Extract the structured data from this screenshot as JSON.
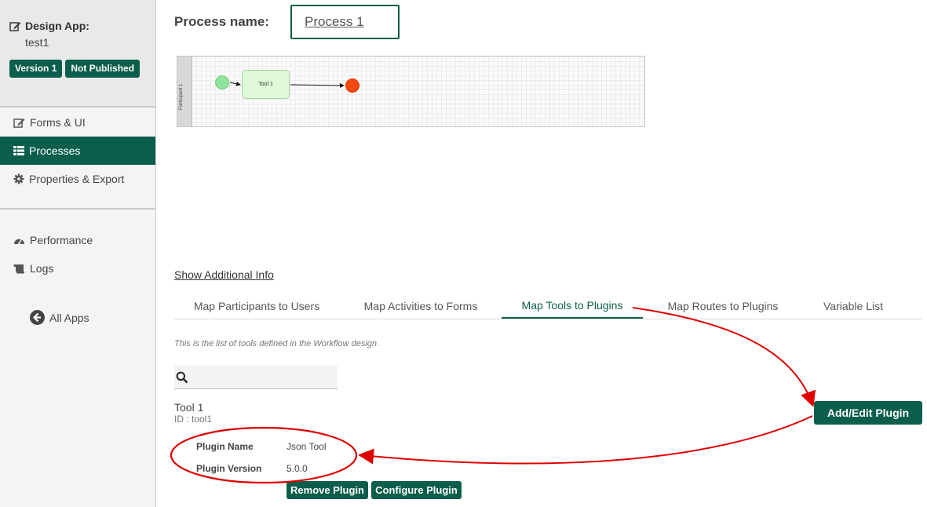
{
  "sidebar": {
    "app_title": "Design App:",
    "app_name": "test1",
    "badges": [
      "Version 1",
      "Not Published"
    ],
    "nav": [
      {
        "label": "Forms & UI",
        "icon": "edit-icon"
      },
      {
        "label": "Processes",
        "icon": "table-icon",
        "active": true
      },
      {
        "label": "Properties & Export",
        "icon": "gear-icon"
      },
      {
        "label": "Performance",
        "icon": "gauge-icon"
      },
      {
        "label": "Logs",
        "icon": "scroll-icon"
      }
    ],
    "all_apps": "All Apps"
  },
  "main": {
    "process_label": "Process name:",
    "process_name": "Process 1",
    "diagram": {
      "lane_label": "Participant 1",
      "tool_node": "Tool 1"
    },
    "show_info": "Show Additional Info",
    "tabs": [
      {
        "label": "Map Participants to Users"
      },
      {
        "label": "Map Activities to Forms"
      },
      {
        "label": "Map Tools to Plugins",
        "active": true
      },
      {
        "label": "Map Routes to Plugins"
      },
      {
        "label": "Variable List"
      }
    ],
    "description": "This is the list of tools defined in the Workflow design.",
    "tool": {
      "name": "Tool 1",
      "id": "ID : tool1",
      "plugin_name_label": "Plugin Name",
      "plugin_name_value": "Json Tool",
      "plugin_version_label": "Plugin Version",
      "plugin_version_value": "5.0.0"
    },
    "buttons": {
      "remove": "Remove Plugin",
      "configure": "Configure Plugin",
      "add_edit": "Add/Edit Plugin"
    }
  },
  "colors": {
    "accent": "#0b5e4b",
    "annotation": "#e00000",
    "start_event": "#8fe39a",
    "end_event": "#f24a12"
  }
}
